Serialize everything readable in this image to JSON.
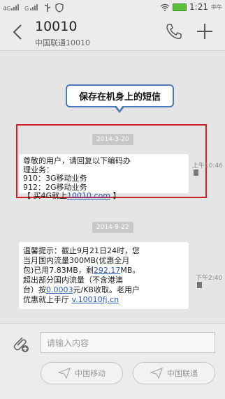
{
  "statusbar": {
    "signal1": "4G",
    "signal2": "G",
    "time": "1:21",
    "ampm": "中午"
  },
  "header": {
    "title": "10010",
    "subtitle": "中国联通10010"
  },
  "callout": {
    "text": "保存在机身上的短信"
  },
  "messages": [
    {
      "date": "2014-3-20",
      "lines": [
        "尊敬的用户，请回复以下编码办",
        "理业务：",
        "910：3G移动业务",
        "912：2G移动业务"
      ],
      "last_prefix": "【 买4G就上",
      "last_link": "10010.com",
      "last_suffix": " 】",
      "time": "上午10:46"
    },
    {
      "date": "2014-9-22",
      "line1": "温馨提示：截止9月21日24时，您",
      "line2": "当月国内流量300MB(优惠全月",
      "line3_prefix": "包)已用7.83MB，剩",
      "line3_link": "292.17",
      "line3_suffix": "MB。",
      "line4": "超出部分国内流量（不含港澳",
      "line5_prefix": "台）按",
      "line5_link": "0.0003",
      "line5_suffix": "元/KB收取。老用户",
      "line6_prefix": "优惠就上手厅 ",
      "line6_link": "v.10010fj.cn",
      "time": "下午2:40"
    }
  ],
  "composer": {
    "placeholder": "请输入内容",
    "send_labels": [
      "中国移动",
      "中国联通"
    ]
  }
}
